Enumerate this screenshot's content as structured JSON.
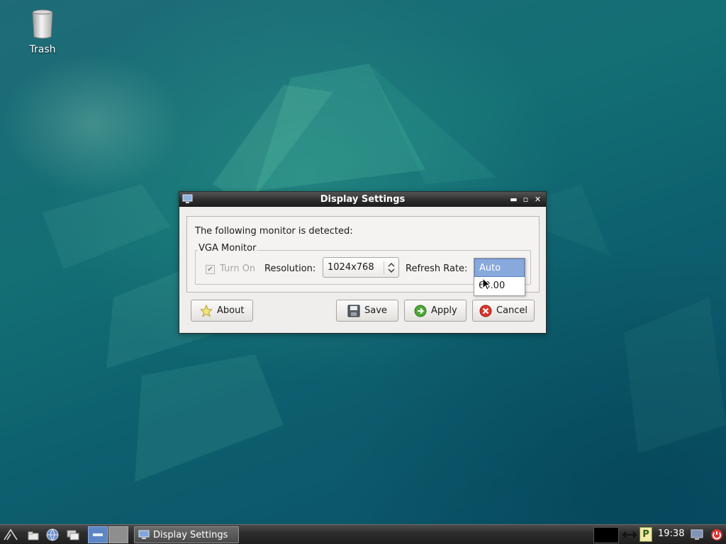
{
  "desktop": {
    "icons": [
      {
        "label": "Trash",
        "icon": "trash-icon"
      }
    ]
  },
  "window": {
    "title": "Display Settings",
    "icon": "monitor-icon",
    "controls": {
      "minimize": "minimize-icon",
      "maximize": "maximize-icon",
      "close": "close-icon"
    },
    "detected_text": "The following monitor is detected:",
    "group": {
      "title": "VGA Monitor",
      "turn_on": {
        "label": "Turn On",
        "checked": true,
        "enabled": false
      },
      "resolution_label": "Resolution:",
      "resolution_value": "1024x768",
      "refresh_label": "Refresh Rate:",
      "refresh_options": [
        "Auto",
        "60.00"
      ],
      "refresh_selected": "Auto"
    },
    "buttons": {
      "about": "About",
      "save": "Save",
      "apply": "Apply",
      "cancel": "Cancel"
    }
  },
  "taskbar": {
    "launchers": [
      "menu-icon",
      "file-manager-icon",
      "browser-icon",
      "desktop-switch-icon",
      "workspace-1-icon",
      "workspace-2-icon"
    ],
    "task_button": "Display Settings",
    "tray": [
      "cpu-monitor-icon",
      "network-icon",
      "clipboard-icon",
      "screen-icon",
      "power-icon"
    ],
    "clock": "19:38"
  },
  "colors": {
    "desktop_bg": "#136f74",
    "titlebar": "#2d2d2d",
    "dropdown_selection": "#88a9dc"
  }
}
